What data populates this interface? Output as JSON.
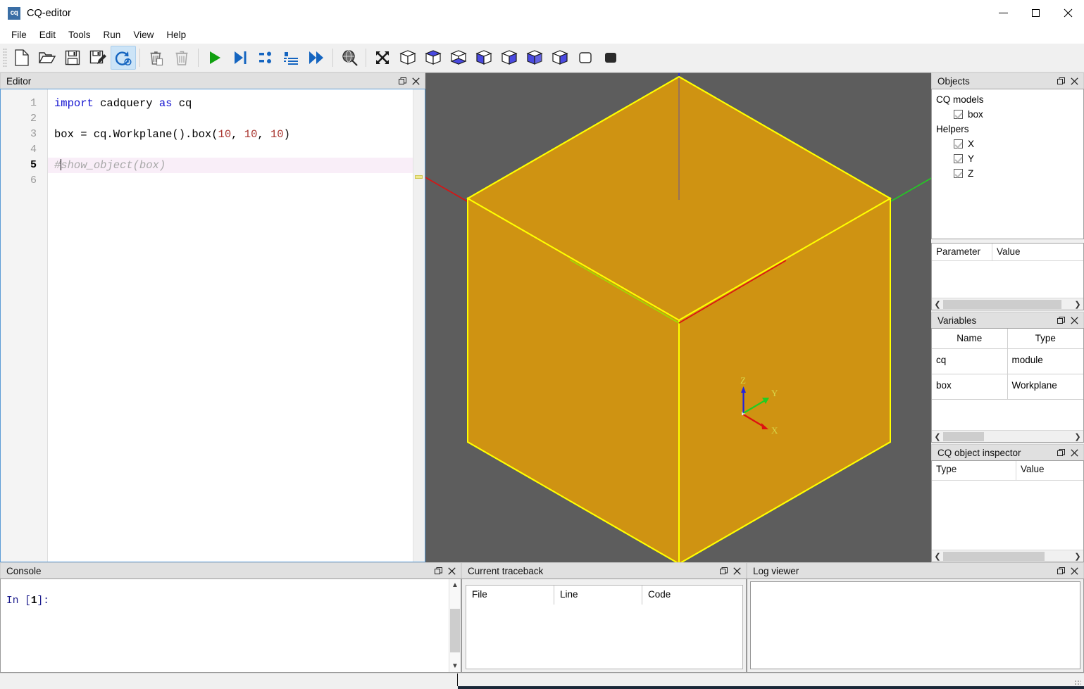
{
  "window": {
    "title": "CQ-editor",
    "logo_text": "cq",
    "buttons": {
      "minimize": "minimize-icon",
      "maximize": "maximize-icon",
      "close": "close-icon"
    }
  },
  "menubar": {
    "items": [
      {
        "label": "File"
      },
      {
        "label": "Edit"
      },
      {
        "label": "Tools"
      },
      {
        "label": "Run"
      },
      {
        "label": "View"
      },
      {
        "label": "Help"
      }
    ]
  },
  "toolbar": {
    "groups": [
      {
        "buttons": [
          {
            "name": "new-file-button",
            "icon": "new-document-icon",
            "active": false
          },
          {
            "name": "open-file-button",
            "icon": "open-folder-icon",
            "active": false
          },
          {
            "name": "save-file-button",
            "icon": "floppy-save-icon",
            "active": false
          },
          {
            "name": "save-as-button",
            "icon": "floppy-save-as-icon",
            "active": false
          },
          {
            "name": "auto-reload-button",
            "icon": "reload-clock-icon",
            "active": true
          }
        ]
      },
      {
        "buttons": [
          {
            "name": "clear-current-button",
            "icon": "trash-partial-icon",
            "active": false
          },
          {
            "name": "clear-all-button",
            "icon": "trash-icon",
            "active": false
          }
        ]
      },
      {
        "buttons": [
          {
            "name": "render-button",
            "icon": "play-triangle-icon",
            "active": false
          },
          {
            "name": "debug-button",
            "icon": "step-to-end-icon",
            "active": false
          },
          {
            "name": "step-button",
            "icon": "step-over-icon",
            "active": false
          },
          {
            "name": "step-in-button",
            "icon": "step-into-icon",
            "active": false
          },
          {
            "name": "continue-button",
            "icon": "fast-forward-icon",
            "active": false
          }
        ]
      },
      {
        "buttons": [
          {
            "name": "fit-screen-button",
            "icon": "magnifier-globe-icon",
            "active": false
          }
        ]
      },
      {
        "buttons": [
          {
            "name": "fit-all-button",
            "icon": "four-arrows-icon",
            "active": false
          },
          {
            "name": "view-iso-button",
            "icon": "cube-iso-icon",
            "active": false
          },
          {
            "name": "view-top-button",
            "icon": "cube-top-icon",
            "active": false
          },
          {
            "name": "view-bottom-button",
            "icon": "cube-bottom-icon",
            "active": false
          },
          {
            "name": "view-front-button",
            "icon": "cube-front-icon",
            "active": false
          },
          {
            "name": "view-rear-button",
            "icon": "cube-rear-icon",
            "active": false
          },
          {
            "name": "view-left-button",
            "icon": "cube-left-icon",
            "active": false
          },
          {
            "name": "view-right-button",
            "icon": "cube-right-icon",
            "active": false
          },
          {
            "name": "wireframe-button",
            "icon": "square-outline-icon",
            "active": false
          },
          {
            "name": "shaded-button",
            "icon": "square-filled-icon",
            "active": false
          }
        ]
      }
    ]
  },
  "editor": {
    "title": "Editor",
    "line_numbers": [
      "1",
      "2",
      "3",
      "4",
      "5",
      "6"
    ],
    "current_line": 5,
    "lines": [
      {
        "n": 1,
        "text": "import cadquery as cq"
      },
      {
        "n": 2,
        "text": ""
      },
      {
        "n": 3,
        "text": "box = cq.Workplane().box(10, 10, 10)"
      },
      {
        "n": 4,
        "text": ""
      },
      {
        "n": 5,
        "text": "#show_object(box)"
      },
      {
        "n": 6,
        "text": ""
      }
    ],
    "tokens": {
      "kw_import": "import",
      "kw_as": "as",
      "id_cadquery": " cadquery ",
      "id_cq": " cq",
      "line3_a": "box = cq.Workplane().box(",
      "line3_n1": "10",
      "line3_c1": ", ",
      "line3_n2": "10",
      "line3_c2": ", ",
      "line3_n3": "10",
      "line3_b": ")",
      "line5_hash": "#",
      "line5_comment": "show_object(box)"
    }
  },
  "viewport": {
    "background_color": "#5d5d5d",
    "shape_face_color": "#cf9312",
    "shape_edge_color": "#ffff00",
    "axes": {
      "x_color": "#dd1111",
      "y_color": "#22cc22",
      "z_color": "#2222dd"
    },
    "triad": {
      "x_label": "X",
      "y_label": "Y",
      "z_label": "Z",
      "label_color": "#d8d84a"
    }
  },
  "objects_panel": {
    "title": "Objects",
    "groups": [
      {
        "label": "CQ models",
        "children": [
          {
            "label": "box",
            "checked": true
          }
        ]
      },
      {
        "label": "Helpers",
        "children": [
          {
            "label": "X",
            "checked": true
          },
          {
            "label": "Y",
            "checked": true
          },
          {
            "label": "Z",
            "checked": true
          }
        ]
      }
    ],
    "params_table": {
      "headers": [
        "Parameter",
        "Value"
      ],
      "rows": []
    }
  },
  "variables_panel": {
    "title": "Variables",
    "headers": [
      "Name",
      "Type"
    ],
    "rows": [
      {
        "name": "cq",
        "type": "module"
      },
      {
        "name": "box",
        "type": "Workplane"
      }
    ]
  },
  "inspector_panel": {
    "title": "CQ object inspector",
    "headers": [
      "Type",
      "Value"
    ],
    "rows": []
  },
  "console_panel": {
    "title": "Console",
    "prompt_prefix": "In [",
    "prompt_number": "1",
    "prompt_suffix": "]:"
  },
  "traceback_panel": {
    "title": "Current traceback",
    "headers": [
      "File",
      "Line",
      "Code"
    ],
    "rows": []
  },
  "log_panel": {
    "title": "Log viewer",
    "content": ""
  },
  "dock_controls": {
    "float_icon": "float-window-icon",
    "close_icon": "close-icon"
  }
}
